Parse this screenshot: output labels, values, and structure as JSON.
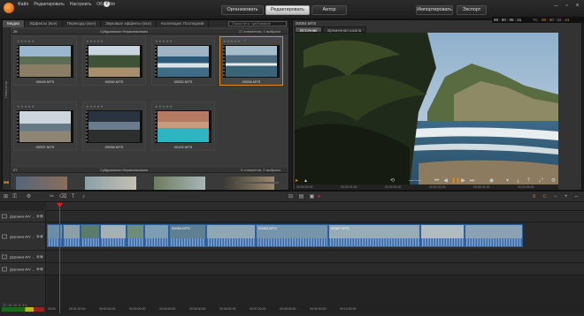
{
  "menu": [
    "Файл",
    "Редактировать",
    "Настроить",
    "Об within"
  ],
  "modes": {
    "organize": "Организовать",
    "edit": "Редактировать",
    "author": "Автор"
  },
  "import_label": "Импортировать",
  "export_label": "Экспорт",
  "top_timecode_label": "TC",
  "top_timecode": "00 : 00 : 02 : 24",
  "top_duration": "00 : 00 : 05 : 21",
  "library": {
    "tabs": [
      "Медиа",
      "Эффекты (все)",
      "Переходы (все)",
      "Звуковые эффекты (все)",
      "Коллекции: Последний"
    ],
    "search_placeholder": "Поиск/теги: требование",
    "side_label": "Навигатор",
    "group1": {
      "num": "26",
      "label": "Субдиапазон Нераспаковано",
      "count": "17 элементов, 1 выбрано"
    },
    "group2": {
      "num": "27",
      "label": "Субдиапазон Нераспаковано",
      "count": "5 элементов, 0 выбрано"
    },
    "clips": [
      "00049.MTS",
      "00050.MTS",
      "00052.MTS",
      "00054.MTS",
      "00057.MTS",
      "00058.MTS",
      "00102.MTS"
    ],
    "selected_index": 3,
    "stars": "★★★★★"
  },
  "player": {
    "title": "00054.MTS",
    "tabs": [
      "Источник",
      "Временная шкала"
    ],
    "bar_ticks": [
      "00:00:00.00",
      "00:00:01.00",
      "00:00:02.00",
      "00:00:03.00",
      "00:00:04.00",
      "00:00:05.00"
    ]
  },
  "timeline": {
    "tracks": [
      "Дорожка А/V ...",
      "Дорожка А/V ...",
      "Дорожка А/V ...",
      "Дорожка А/V ..."
    ],
    "clip_labels": [
      "",
      "",
      "",
      "",
      "",
      "",
      "00054.MTS",
      "",
      "00052.MTS",
      "",
      "00057.MTS",
      ""
    ],
    "ruler_ticks": [
      "00:00",
      "00:01:00:00",
      "00:02:00:00",
      "00:03:00:00",
      "00:04:00:00",
      "00:05:00:00",
      "00:06:00:00",
      "00:07:00:00",
      "00:08:00:00",
      "00:09:00:00",
      "00:10:00:00"
    ],
    "meter_label": "-22 -16 -10 -6 -3 0"
  },
  "colors": {
    "accent": "#e08a1e",
    "clip_blue": "#4f7db5",
    "playhead": "#e02020",
    "check": "#2ea84a"
  }
}
